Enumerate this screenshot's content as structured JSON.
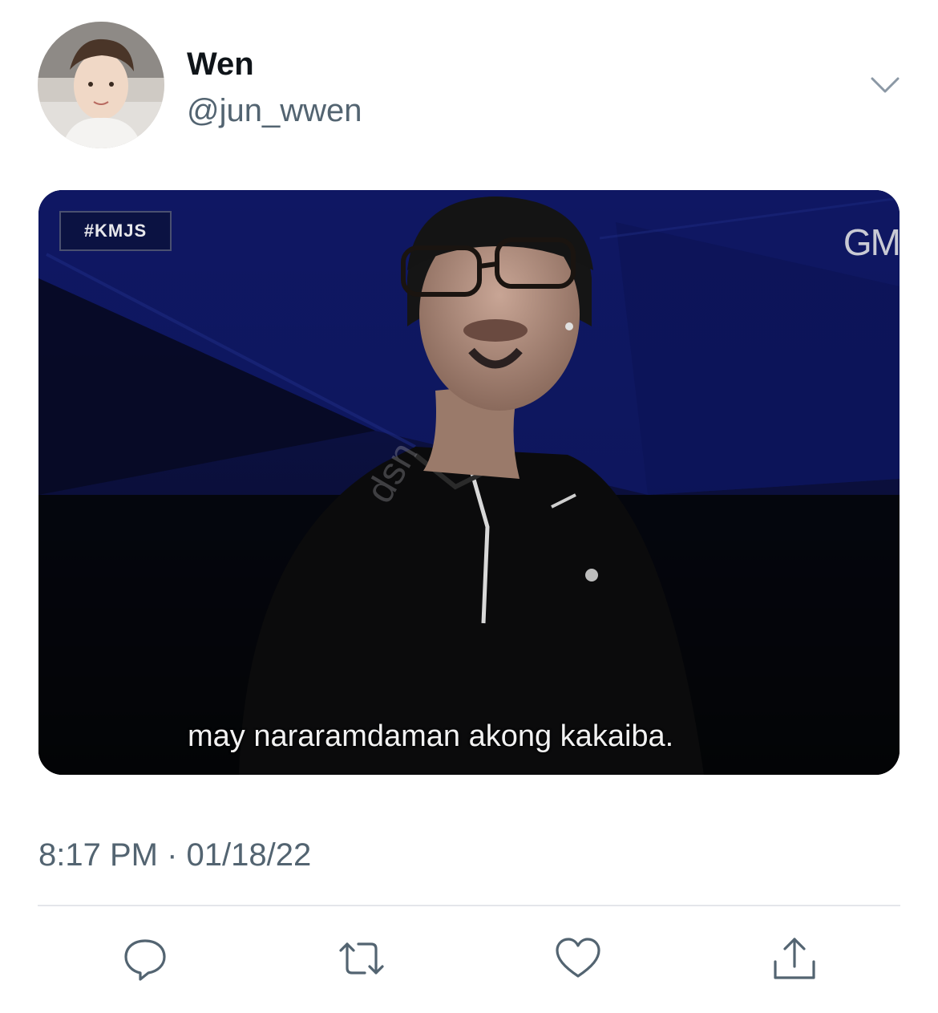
{
  "author": {
    "display_name": "Wen",
    "handle": "@jun_wwen"
  },
  "media": {
    "overlay_tag": "#KMJS",
    "overlay_logo": "GM",
    "watermark": "dsn",
    "caption": "may nararamdaman akong kakaiba."
  },
  "timestamp": "8:17 PM · 01/18/22",
  "actions": {
    "reply_icon": "reply-icon",
    "retweet_icon": "retweet-icon",
    "like_icon": "heart-icon",
    "share_icon": "share-icon"
  },
  "colors": {
    "text_primary": "#0f1419",
    "text_secondary": "#536471",
    "divider": "#e4e6ea"
  }
}
